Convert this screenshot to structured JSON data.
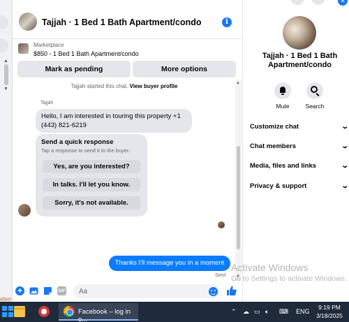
{
  "header": {
    "title": "Tajjah · 1 Bed 1 Bath Apartment/condo"
  },
  "listing": {
    "source": "Marketplace",
    "description": "$850 - 1 Bed 1 Bath Apartment/condo",
    "mark_pending_label": "Mark as pending",
    "more_options_label": "More options"
  },
  "messages": {
    "started_prefix": "Tajjah started this chat.",
    "view_profile_link": "View buyer profile",
    "sender_name": "Tajjah",
    "incoming_text": "Hello, I am interested in touring this property +1 (443) 821-6219",
    "quick_response": {
      "title": "Send a quick response",
      "subtitle": "Tap a response to send it to the buyer.",
      "options": [
        "Yes, are you interested?",
        "In talks. I'll let you know.",
        "Sorry, it's not available."
      ]
    },
    "outgoing_text": "Thanks I'll message you in a moment",
    "sent_label": "Sent"
  },
  "composer": {
    "placeholder": "Aa"
  },
  "right_panel": {
    "title": "Tajjah · 1 Bed 1 Bath Apartment/condo",
    "mute_label": "Mute",
    "search_label": "Search",
    "sections": [
      "Customize chat",
      "Chat members",
      "Media, files and links",
      "Privacy & support"
    ]
  },
  "watermark": {
    "line1": "Activate Windows",
    "line2": "Go to Settings to activate Windows."
  },
  "left_strip": {
    "text": "eferr"
  },
  "taskbar": {
    "active_task": "Facebook – log in o...",
    "language": "ENG",
    "time": "9:19 PM",
    "date": "3/18/2025"
  },
  "colors": {
    "accent": "#1877f2",
    "outgoing_bubble": "#0a7cff",
    "incoming_bubble": "#e4e6eb",
    "taskbar": "#1f2a3a"
  },
  "icons": [
    "info-icon",
    "plus-icon",
    "image-icon",
    "sticker-icon",
    "gif-icon",
    "emoji-icon",
    "like-icon",
    "bell-icon",
    "search-icon",
    "chevron-down-icon"
  ]
}
